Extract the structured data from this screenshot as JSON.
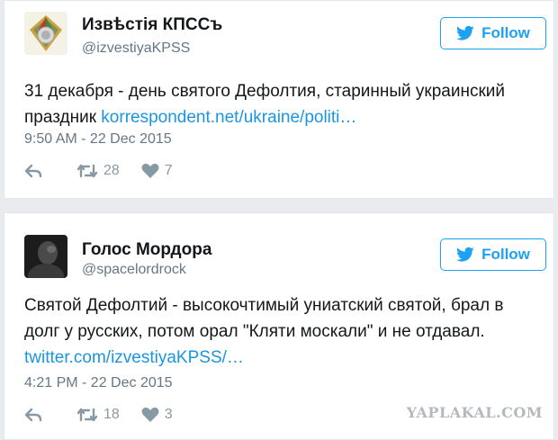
{
  "tweets": [
    {
      "name": "Извѣстія КПССъ",
      "handle": "@izvestiyaKPSS",
      "follow_label": "Follow",
      "text": "31 декабря - день святого Дефолтия, старинный украинский праздник",
      "link": "korrespondent.net/ukraine/politi…",
      "time": "9:50 AM - 22 Dec 2015",
      "retweets": "28",
      "likes": "7"
    },
    {
      "name": "Голос Мордора",
      "handle": "@spacelordrock",
      "follow_label": "Follow",
      "text_line1": "Святой Дефолтий - высокочтимый униатский святой, брал в",
      "text_line2": "долг у русских, потом орал \"Кляти москали\" и не отдавал.",
      "link": "twitter.com/izvestiyaKPSS/…",
      "time": "4:21 PM - 22 Dec 2015",
      "retweets": "18",
      "likes": "3"
    }
  ],
  "watermark": "YAPLAKAL.COM",
  "colors": {
    "link": "#1b95e0",
    "follow": "#1da1f2",
    "muted": "#657786"
  }
}
